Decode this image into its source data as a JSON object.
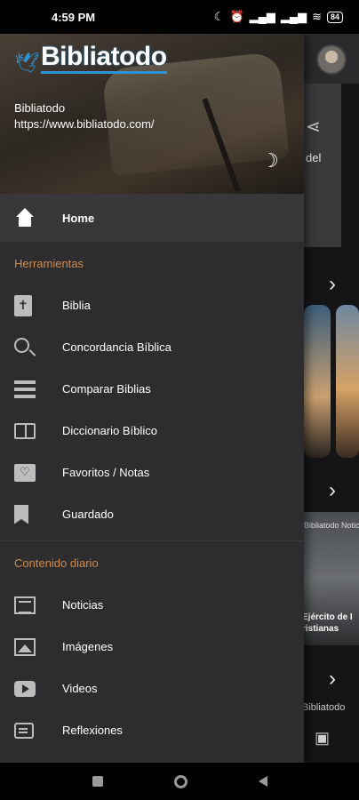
{
  "status_bar": {
    "time": "4:59 PM",
    "battery": "84"
  },
  "background": {
    "card_text": "del",
    "news_header": "Bibliatodo Notic",
    "news_title_1": "Ejército de I",
    "news_title_2": "ristianas",
    "bottom_text": "Bibliatodo"
  },
  "drawer": {
    "logo": "Bibliatodo",
    "site_name": "Bibliatodo",
    "site_url": "https://www.bibliatodo.com/",
    "home_label": "Home",
    "section_tools": "Herramientas",
    "tools": [
      {
        "label": "Biblia",
        "icon": "bible-icon"
      },
      {
        "label": "Concordancia Bíblica",
        "icon": "search-icon"
      },
      {
        "label": "Comparar Biblias",
        "icon": "stack-icon"
      },
      {
        "label": "Diccionario Bíblico",
        "icon": "book-icon"
      },
      {
        "label": "Favoritos / Notas",
        "icon": "folder-heart-icon"
      },
      {
        "label": "Guardado",
        "icon": "bookmark-icon"
      }
    ],
    "section_daily": "Contenido diario",
    "daily": [
      {
        "label": "Noticias",
        "icon": "news-icon"
      },
      {
        "label": "Imágenes",
        "icon": "image-icon"
      },
      {
        "label": "Videos",
        "icon": "video-icon"
      },
      {
        "label": "Reflexiones",
        "icon": "chat-icon"
      }
    ]
  },
  "colors": {
    "section_header": "#d08a4c",
    "drawer_bg": "#2d2d30",
    "accent_logo": "#2e93d6"
  }
}
